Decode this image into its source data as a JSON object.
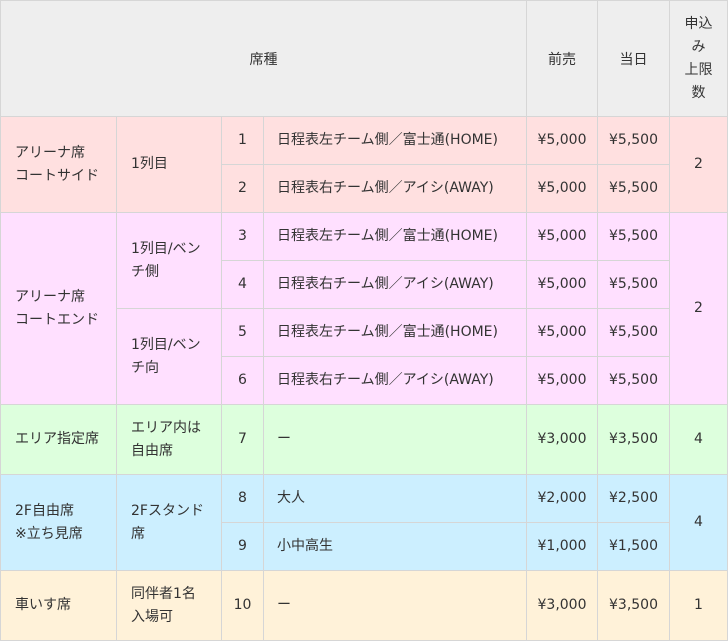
{
  "header": {
    "seat_type": "席種",
    "advance": "前売",
    "door": "当日",
    "limit_lines": [
      "申込",
      "み",
      "上限",
      "数"
    ]
  },
  "groups": [
    {
      "bg": "#ffe0e0",
      "name_lines": [
        "アリーナ席",
        "コートサイド"
      ],
      "limit": "2",
      "subs": [
        {
          "name_lines": [
            "1列目"
          ],
          "rows": [
            {
              "no": "1",
              "seat": "日程表左チーム側／富士通(HOME)",
              "advance": "¥5,000",
              "door": "¥5,500"
            },
            {
              "no": "2",
              "seat": "日程表右チーム側／アイシ(AWAY)",
              "advance": "¥5,000",
              "door": "¥5,500"
            }
          ]
        }
      ]
    },
    {
      "bg": "#ffe0ff",
      "name_lines": [
        "アリーナ席",
        "コートエンド"
      ],
      "limit": "2",
      "subs": [
        {
          "name_lines": [
            "1列目/ベン",
            "チ側"
          ],
          "rows": [
            {
              "no": "3",
              "seat": "日程表左チーム側／富士通(HOME)",
              "advance": "¥5,000",
              "door": "¥5,500"
            },
            {
              "no": "4",
              "seat": "日程表右チーム側／アイシ(AWAY)",
              "advance": "¥5,000",
              "door": "¥5,500"
            }
          ]
        },
        {
          "name_lines": [
            "1列目/ベン",
            "チ向"
          ],
          "rows": [
            {
              "no": "5",
              "seat": "日程表左チーム側／富士通(HOME)",
              "advance": "¥5,000",
              "door": "¥5,500"
            },
            {
              "no": "6",
              "seat": "日程表右チーム側／アイシ(AWAY)",
              "advance": "¥5,000",
              "door": "¥5,500"
            }
          ]
        }
      ]
    },
    {
      "bg": "#ddffdd",
      "name_lines": [
        "エリア指定席"
      ],
      "limit": "4",
      "subs": [
        {
          "name_lines": [
            "エリア内は",
            "自由席"
          ],
          "rows": [
            {
              "no": "7",
              "seat": "ー",
              "advance": "¥3,000",
              "door": "¥3,500"
            }
          ]
        }
      ]
    },
    {
      "bg": "#ccefff",
      "name_lines": [
        "2F自由席",
        "※立ち見席"
      ],
      "limit": "4",
      "subs": [
        {
          "name_lines": [
            "2Fスタンド",
            "席"
          ],
          "rows": [
            {
              "no": "8",
              "seat": "大人",
              "advance": "¥2,000",
              "door": "¥2,500"
            },
            {
              "no": "9",
              "seat": "小中高生",
              "advance": "¥1,000",
              "door": "¥1,500"
            }
          ]
        }
      ]
    },
    {
      "bg": "#fff2d9",
      "name_lines": [
        "車いす席"
      ],
      "limit": "1",
      "subs": [
        {
          "name_lines": [
            "同伴者1名",
            "入場可"
          ],
          "rows": [
            {
              "no": "10",
              "seat": "ー",
              "advance": "¥3,000",
              "door": "¥3,500"
            }
          ]
        }
      ]
    }
  ]
}
